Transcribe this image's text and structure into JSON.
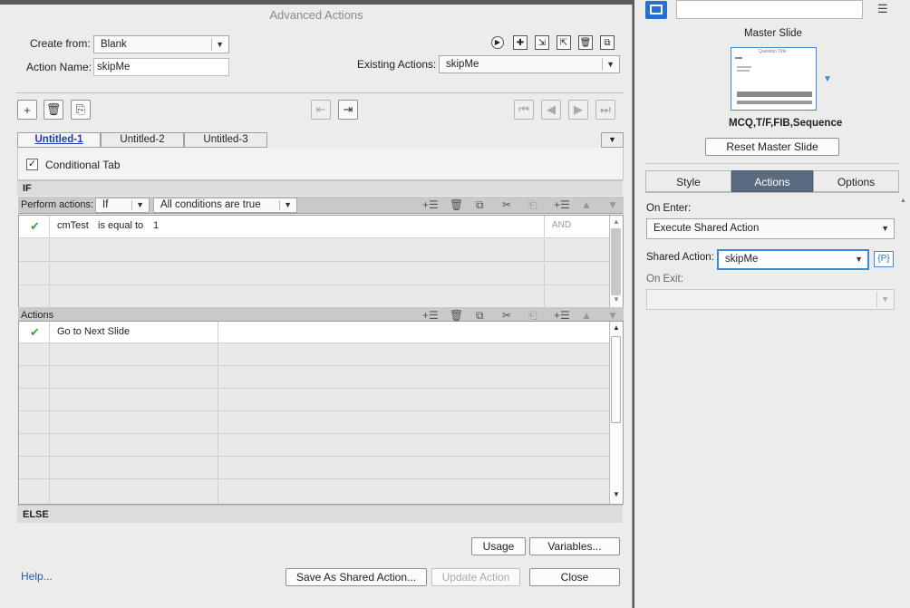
{
  "dialog": {
    "title": "Advanced Actions",
    "create_from_label": "Create from:",
    "create_from_value": "Blank",
    "action_name_label": "Action Name:",
    "action_name_value": "skipMe",
    "existing_actions_label": "Existing Actions:",
    "existing_actions_value": "skipMe",
    "tabs": [
      "Untitled-1",
      "Untitled-2",
      "Untitled-3"
    ],
    "conditional_tab_label": "Conditional Tab",
    "conditional_tab_checked": true,
    "if_label": "IF",
    "perform_actions_label": "Perform actions:",
    "perform_if_value": "If",
    "conditions_value": "All conditions are true",
    "conditions": [
      {
        "variable": "cmTest",
        "operator": "is equal to",
        "value": "1",
        "connector": "AND"
      }
    ],
    "actions_label": "Actions",
    "actions": [
      {
        "action": "Go to Next Slide"
      }
    ],
    "else_label": "ELSE",
    "usage_button": "Usage",
    "variables_button": "Variables...",
    "help_link": "Help...",
    "save_shared_button": "Save As Shared Action...",
    "update_button": "Update Action",
    "close_button": "Close",
    "accent_color": "#1a3fb5"
  },
  "panel": {
    "master_slide_label": "Master Slide",
    "thumb_title": "Question Title",
    "master_name": "MCQ,T/F,FIB,Sequence",
    "reset_button": "Reset Master Slide",
    "tabs": [
      "Style",
      "Actions",
      "Options"
    ],
    "active_tab": "Actions",
    "on_enter_label": "On Enter:",
    "on_enter_value": "Execute Shared Action",
    "shared_action_label": "Shared Action:",
    "shared_action_value": "skipMe",
    "param_button": "{P}",
    "on_exit_label": "On Exit:",
    "on_exit_value": ""
  }
}
